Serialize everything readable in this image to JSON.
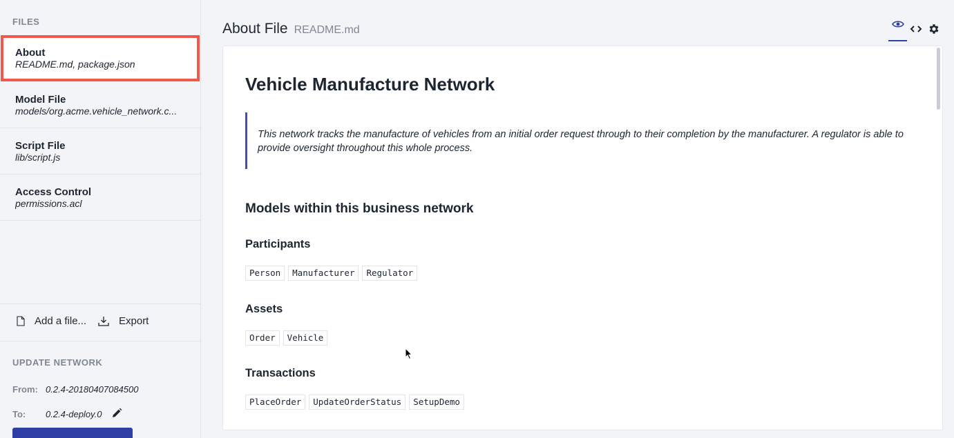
{
  "sidebar": {
    "files_heading": "FILES",
    "files": [
      {
        "title": "About",
        "subtitle": "README.md, package.json",
        "active": true
      },
      {
        "title": "Model File",
        "subtitle": "models/org.acme.vehicle_network.c...",
        "active": false
      },
      {
        "title": "Script File",
        "subtitle": "lib/script.js",
        "active": false
      },
      {
        "title": "Access Control",
        "subtitle": "permissions.acl",
        "active": false
      }
    ],
    "add_file_label": "Add a file...",
    "export_label": "Export",
    "update_heading": "UPDATE NETWORK",
    "from_label": "From:",
    "from_value": "0.2.4-20180407084500",
    "to_label": "To:",
    "to_value": "0.2.4-deploy.0"
  },
  "header": {
    "title": "About File",
    "filename": "README.md"
  },
  "icons": {
    "preview": "eye-icon",
    "code": "code-icon",
    "settings": "gear-icon",
    "add_file": "file-icon",
    "export": "download-icon",
    "edit": "pencil-icon"
  },
  "colors": {
    "accent": "#2e3fa6",
    "active_outline": "#f2574b",
    "quote_border": "#3f4fb5"
  },
  "document": {
    "title": "Vehicle Manufacture Network",
    "quote": "This network tracks the manufacture of vehicles from an initial order request through to their completion by the manufacturer. A regulator is able to provide oversight throughout this whole process.",
    "models_heading": "Models within this business network",
    "participants_heading": "Participants",
    "participants": [
      "Person",
      "Manufacturer",
      "Regulator"
    ],
    "assets_heading": "Assets",
    "assets": [
      "Order",
      "Vehicle"
    ],
    "transactions_heading": "Transactions",
    "transactions": [
      "PlaceOrder",
      "UpdateOrderStatus",
      "SetupDemo"
    ]
  }
}
